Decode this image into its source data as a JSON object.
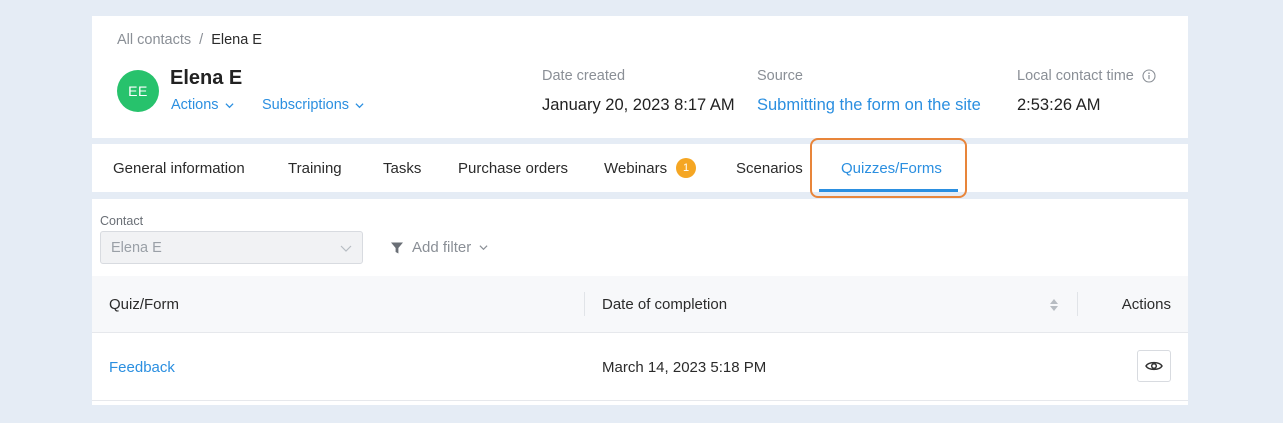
{
  "breadcrumb": {
    "parent": "All contacts",
    "separator": "/",
    "current": "Elena E"
  },
  "contact": {
    "initials": "EE",
    "name": "Elena E",
    "avatar_color": "#27c26c",
    "actions_label": "Actions",
    "subscriptions_label": "Subscriptions"
  },
  "meta": {
    "date_created_label": "Date created",
    "date_created_value": "January 20, 2023 8:17 AM",
    "source_label": "Source",
    "source_value": "Submitting the form on the site",
    "local_time_label": "Local contact time",
    "local_time_value": "2:53:26 AM"
  },
  "tabs": [
    {
      "label": "General information"
    },
    {
      "label": "Training"
    },
    {
      "label": "Tasks"
    },
    {
      "label": "Purchase orders"
    },
    {
      "label": "Webinars",
      "badge": "1"
    },
    {
      "label": "Scenarios"
    },
    {
      "label": "Quizzes/Forms",
      "active": true
    }
  ],
  "filters": {
    "contact_label": "Contact",
    "contact_value": "Elena E",
    "add_filter_label": "Add filter"
  },
  "table": {
    "columns": [
      "Quiz/Form",
      "Date of completion",
      "Actions"
    ],
    "rows": [
      {
        "quiz": "Feedback",
        "date": "March 14, 2023 5:18 PM"
      }
    ]
  },
  "colors": {
    "accent": "#2b8fe0",
    "badge": "#f5a623",
    "highlight": "#e8853a",
    "background": "#e5ecf5"
  }
}
